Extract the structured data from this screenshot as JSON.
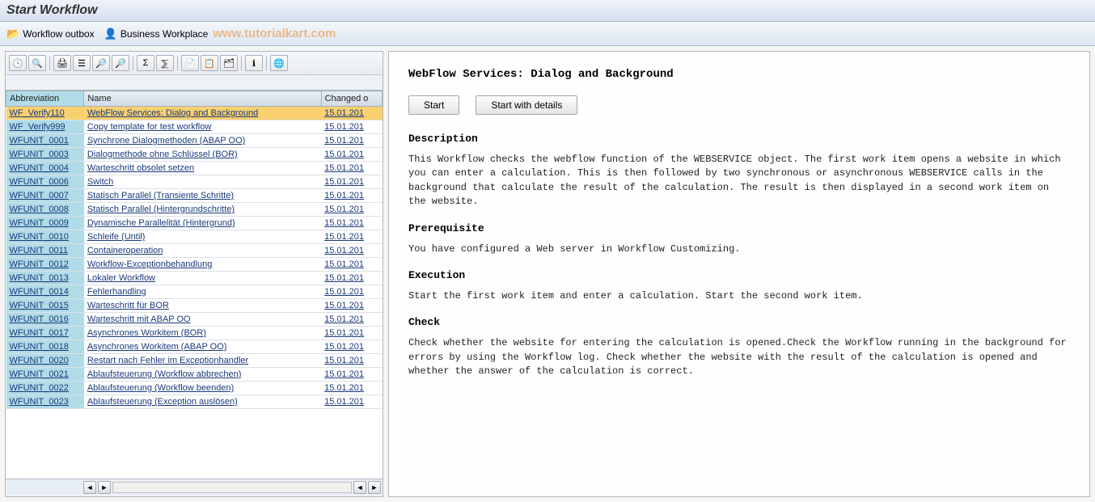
{
  "page_title": "Start Workflow",
  "toolbar": {
    "outbox_label": "Workflow outbox",
    "workplace_label": "Business Workplace",
    "watermark": "www.tutorialkart.com"
  },
  "icon_toolbar": [
    {
      "name": "execute-icon",
      "glyph": "🕓"
    },
    {
      "name": "display-icon",
      "glyph": "🔍"
    },
    {
      "sep": true
    },
    {
      "name": "print-icon",
      "glyph": "🖨"
    },
    {
      "name": "filter-icon",
      "glyph": "☰"
    },
    {
      "name": "find-icon",
      "glyph": "🔎"
    },
    {
      "name": "find-next-icon",
      "glyph": "🔎"
    },
    {
      "sep": true
    },
    {
      "name": "sum-icon",
      "glyph": "Σ"
    },
    {
      "name": "subtotal-icon",
      "glyph": "⅀"
    },
    {
      "sep": true
    },
    {
      "name": "export-icon",
      "glyph": "📄"
    },
    {
      "name": "layout-icon",
      "glyph": "📋"
    },
    {
      "name": "select-layout-icon",
      "glyph": "🗂"
    },
    {
      "sep": true
    },
    {
      "name": "info-icon",
      "glyph": "ℹ"
    },
    {
      "sep": true
    },
    {
      "name": "chart-icon",
      "glyph": "🌐"
    }
  ],
  "table": {
    "columns": {
      "abbr": "Abbreviation",
      "name": "Name",
      "changed": "Changed o"
    },
    "rows": [
      {
        "abbr": "WF_Verify110",
        "name": "WebFlow Services: Dialog and Background",
        "changed": "15.01.201",
        "selected": true
      },
      {
        "abbr": "WF_Verify999",
        "name": "Copy template for test workflow",
        "changed": "15.01.201"
      },
      {
        "abbr": "WFUNIT_0001",
        "name": "Synchrone Dialogmethoden (ABAP OO)",
        "changed": "15.01.201"
      },
      {
        "abbr": "WFUNIT_0003",
        "name": "Dialogmethode ohne Schlüssel (BOR)",
        "changed": "15.01.201"
      },
      {
        "abbr": "WFUNIT_0004",
        "name": "Warteschritt obsolet setzen",
        "changed": "15.01.201"
      },
      {
        "abbr": "WFUNIT_0006",
        "name": "Switch",
        "changed": "15.01.201"
      },
      {
        "abbr": "WFUNIT_0007",
        "name": "Statisch Parallel (Transiente Schritte)",
        "changed": "15.01.201"
      },
      {
        "abbr": "WFUNIT_0008",
        "name": "Statisch Parallel (Hintergrundschritte)",
        "changed": "15.01.201"
      },
      {
        "abbr": "WFUNIT_0009",
        "name": "Dynamische Parallelität (Hintergrund)",
        "changed": "15.01.201"
      },
      {
        "abbr": "WFUNIT_0010",
        "name": "Schleife (Until)",
        "changed": "15.01.201"
      },
      {
        "abbr": "WFUNIT_0011",
        "name": "Containeroperation",
        "changed": "15.01.201"
      },
      {
        "abbr": "WFUNIT_0012",
        "name": "Workflow-Exceptionbehandlung",
        "changed": "15.01.201"
      },
      {
        "abbr": "WFUNIT_0013",
        "name": "Lokaler Workflow",
        "changed": "15.01.201"
      },
      {
        "abbr": "WFUNIT_0014",
        "name": "Fehlerhandling",
        "changed": "15.01.201"
      },
      {
        "abbr": "WFUNIT_0015",
        "name": "Warteschritt für BOR",
        "changed": "15.01.201"
      },
      {
        "abbr": "WFUNIT_0016",
        "name": "Warteschritt mit ABAP OO",
        "changed": "15.01.201"
      },
      {
        "abbr": "WFUNIT_0017",
        "name": "Asynchrones Workitem (BOR)",
        "changed": "15.01.201"
      },
      {
        "abbr": "WFUNIT_0018",
        "name": "Asynchrones Workitem (ABAP OO)",
        "changed": "15.01.201"
      },
      {
        "abbr": "WFUNIT_0020",
        "name": "Restart nach Fehler im Exceptionhandler",
        "changed": "15.01.201"
      },
      {
        "abbr": "WFUNIT_0021",
        "name": "Ablaufsteuerung (Workflow abbrechen)",
        "changed": "15.01.201"
      },
      {
        "abbr": "WFUNIT_0022",
        "name": "Ablaufsteuerung (Workflow beenden)",
        "changed": "15.01.201"
      },
      {
        "abbr": "WFUNIT_0023",
        "name": "Ablaufsteuerung (Exception auslösen)",
        "changed": "15.01.201"
      }
    ]
  },
  "detail": {
    "title": "WebFlow Services: Dialog and Background",
    "start_label": "Start",
    "start_details_label": "Start with details",
    "sections": [
      {
        "header": "Description",
        "body": "This Workflow checks the webflow function of the WEBSERVICE object. The first work item opens a website in which you can enter a calculation. This is then followed by two synchronous or asynchronous WEBSERVICE calls in the background that calculate the result of the calculation. The result is then displayed in a second work item on the website."
      },
      {
        "header": "Prerequisite",
        "body": "You have configured a Web server in Workflow Customizing."
      },
      {
        "header": "Execution",
        "body": "Start the first work item and enter a calculation. Start the second work item."
      },
      {
        "header": "Check",
        "body": "Check whether the website for entering the calculation is opened.Check the Workflow running in the background for errors by using the Workflow log. Check whether the website with the result of the calculation is opened and whether the answer of the calculation is correct."
      }
    ]
  }
}
